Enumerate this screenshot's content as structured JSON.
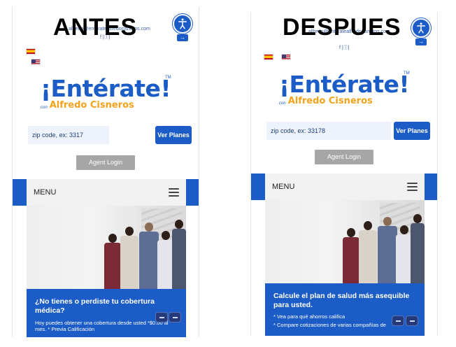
{
  "labels": {
    "before": "ANTES",
    "after": "DESPUES"
  },
  "header": {
    "email_fragment": "alfredo@enteratealfredocisneros.com",
    "social": "f |ⓘ|"
  },
  "logo": {
    "main": "¡Entérate!",
    "con": "con",
    "sub": "Alfredo Cisneros",
    "tm": "TM"
  },
  "before": {
    "zip_placeholder": "zip code, ex: 3317",
    "ver_planes": "Ver Planes",
    "agent_login": "Agent Login",
    "menu": "MENU",
    "title": "¿No tienes o perdiste tu cobertura médica?",
    "text": "Hoy puedes obtener una cobertura desde usted *$0.00 al mes. * Previa Calificación"
  },
  "after": {
    "zip_placeholder": "zip code, ex: 33178",
    "ver_planes": "Ver Planes",
    "agent_login": "Agent Login",
    "menu": "MENU",
    "title": "Calcule el plan de salud más asequible para usted.",
    "bullet_1": "* Vea para qué ahorros califica",
    "bullet_2": "* Compare cotizaciones de varias compañías de"
  },
  "icons": [
    "accessibility-icon",
    "arrow-right-icon",
    "spain-flag-icon",
    "us-flag-icon",
    "hamburger-icon",
    "chat-icon",
    "facebook-icon",
    "instagram-icon"
  ],
  "colors": {
    "brand_blue": "#1c5cc6",
    "brand_orange": "#f2a31b",
    "agent_gray": "#a6a6a6"
  }
}
